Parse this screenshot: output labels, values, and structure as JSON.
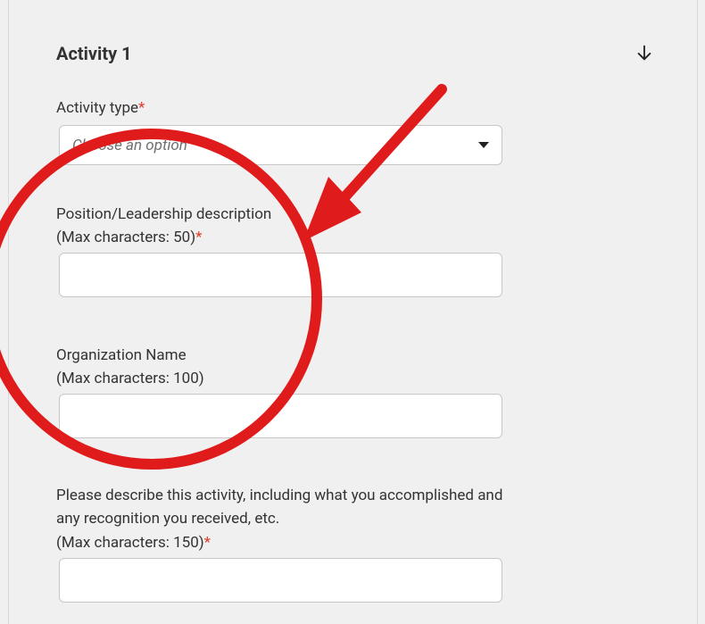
{
  "section": {
    "title": "Activity 1"
  },
  "fields": {
    "activity_type": {
      "label": "Activity type",
      "required_marker": "*",
      "placeholder": "Choose an option"
    },
    "position": {
      "label_line1": "Position/Leadership description",
      "label_line2": "(Max characters: 50)",
      "required_marker": "*",
      "value": ""
    },
    "organization": {
      "label_line1": "Organization Name",
      "label_line2": "(Max characters: 100)",
      "value": ""
    },
    "description": {
      "label_line1": "Please describe this activity, including what you accomplished and any recognition you received, etc.",
      "label_line2": "(Max characters: 150)",
      "required_marker": "*",
      "value": ""
    }
  }
}
